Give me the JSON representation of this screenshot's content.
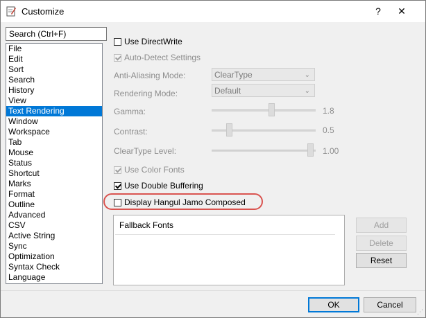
{
  "window": {
    "title": "Customize",
    "help": "?",
    "close": "✕"
  },
  "search": {
    "placeholder": "Search (Ctrl+F)"
  },
  "categories": [
    "File",
    "Edit",
    "Sort",
    "Search",
    "History",
    "View",
    "Text Rendering",
    "Window",
    "Workspace",
    "Tab",
    "Mouse",
    "Status",
    "Shortcut",
    "Marks",
    "Format",
    "Outline",
    "Advanced",
    "CSV",
    "Active String",
    "Sync",
    "Optimization",
    "Syntax Check",
    "Language"
  ],
  "selected_category": "Text Rendering",
  "settings": {
    "use_directwrite": {
      "label": "Use DirectWrite",
      "checked": false,
      "enabled": true
    },
    "auto_detect": {
      "label": "Auto-Detect Settings",
      "checked": true,
      "enabled": false
    },
    "anti_aliasing": {
      "label": "Anti-Aliasing Mode:",
      "value": "ClearType"
    },
    "rendering_mode": {
      "label": "Rendering Mode:",
      "value": "Default"
    },
    "gamma": {
      "label": "Gamma:",
      "value": "1.8"
    },
    "contrast": {
      "label": "Contrast:",
      "value": "0.5"
    },
    "cleartype_level": {
      "label": "ClearType Level:",
      "value": "1.00"
    },
    "use_color_fonts": {
      "label": "Use Color Fonts",
      "checked": true,
      "enabled": false
    },
    "use_double_buffering": {
      "label": "Use Double Buffering",
      "checked": true,
      "enabled": true
    },
    "display_hangul": {
      "label": "Display Hangul Jamo Composed",
      "checked": false,
      "enabled": true
    }
  },
  "fallback": {
    "header": "Fallback Fonts",
    "add": "Add",
    "delete": "Delete",
    "reset": "Reset"
  },
  "footer": {
    "ok": "OK",
    "cancel": "Cancel"
  },
  "colors": {
    "selection": "#0078d7",
    "highlight_ring": "#d9534f"
  }
}
